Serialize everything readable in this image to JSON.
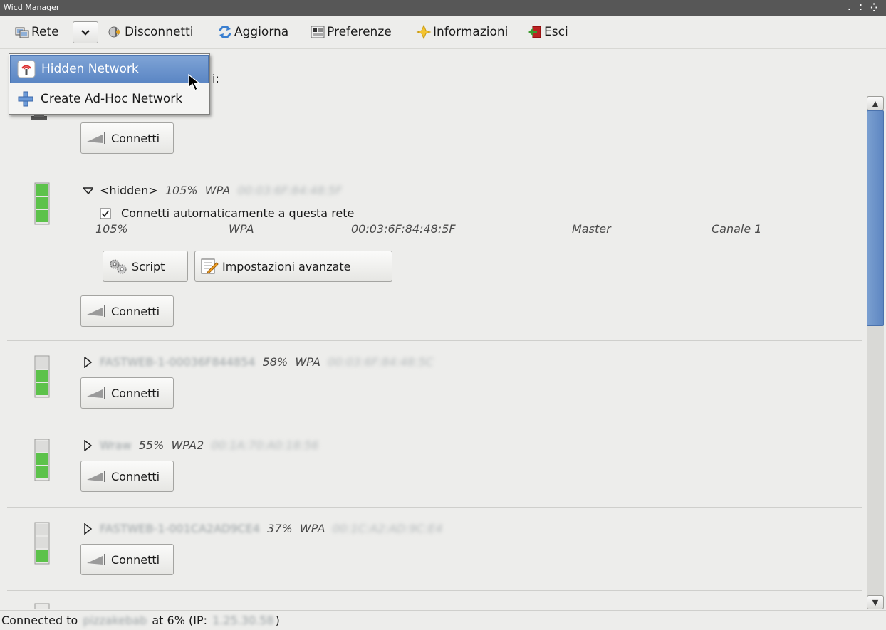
{
  "window": {
    "title": "Wicd Manager",
    "controls": ". ⁚ ⁛"
  },
  "toolbar": {
    "rete": "Rete",
    "disconnect": "Disconnetti",
    "refresh": "Aggiorna",
    "preferences": "Preferenze",
    "info": "Informazioni",
    "quit": "Esci"
  },
  "dropdown_menu": {
    "items": [
      {
        "label": "Hidden Network",
        "icon": "antenna-icon",
        "selected": true
      },
      {
        "label": "Create Ad-Hoc Network",
        "icon": "plus-icon",
        "selected": false
      }
    ]
  },
  "partial_label": "i:",
  "wired": {
    "connect_label": "Connetti"
  },
  "networks": [
    {
      "name": "<hidden>",
      "strength": "105%",
      "encryption": "WPA",
      "bssid": "00:03:6F:84:48:5F",
      "signal": 1.0,
      "expanded": true,
      "auto_connect_label": "Connetti automaticamente a questa rete",
      "auto_connect_checked": true,
      "details": {
        "strength": "105%",
        "encryption": "WPA",
        "bssid": "00:03:6F:84:48:5F",
        "mode": "Master",
        "channel": "Canale 1"
      },
      "script_label": "Script",
      "advanced_label": "Impostazioni avanzate",
      "connect_label": "Connetti"
    },
    {
      "name": "FASTWEB-1-00036F844854",
      "strength": "58%",
      "encryption": "WPA",
      "bssid": "00:03:6F:84:48:5C",
      "signal": 0.58,
      "connect_label": "Connetti"
    },
    {
      "name": "Wraw",
      "strength": "55%",
      "encryption": "WPA2",
      "bssid": "00:1A:70:A0:18:56",
      "signal": 0.55,
      "connect_label": "Connetti"
    },
    {
      "name": "FASTWEB-1-001CA2AD9CE4",
      "strength": "37%",
      "encryption": "WPA",
      "bssid": "00:1C:A2:AD:9C:E4",
      "signal": 0.37,
      "connect_label": "Connetti"
    }
  ],
  "status": {
    "prefix": "Connected to",
    "network": "pizzakebab",
    "middle": "at 6% (IP:",
    "ip": "1.25.30.58",
    "suffix": ")"
  },
  "colors": {
    "accent": "#5b86c4",
    "signal_green": "#5cc24a",
    "titlebar": "#575757"
  }
}
